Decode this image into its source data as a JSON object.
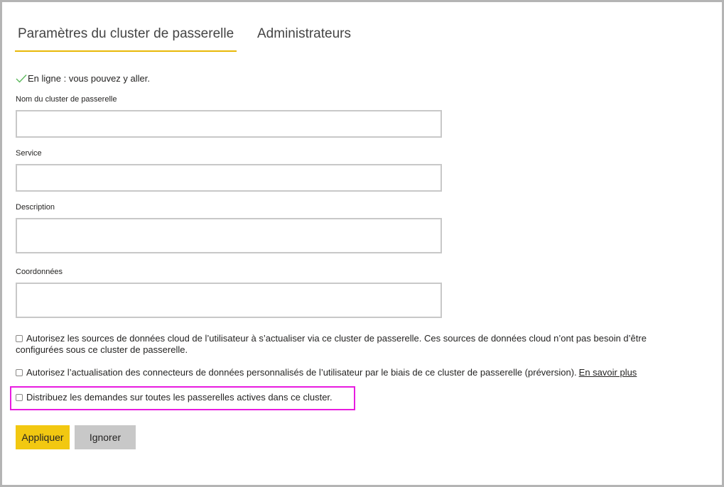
{
  "tabs": {
    "settings": "Paramètres du cluster de passerelle",
    "admins": "Administrateurs"
  },
  "status": {
    "text": "En ligne : vous pouvez y aller.",
    "icon": "check-icon",
    "color": "#5cb85c"
  },
  "form": {
    "cluster_name_label": "Nom du cluster de passerelle",
    "cluster_name_value": "",
    "service_label": "Service",
    "service_value": "",
    "description_label": "Description",
    "description_value": "",
    "contact_label": "Coordonnées",
    "contact_value": ""
  },
  "options": {
    "cloud_sources": "Autorisez les sources de données cloud de l’utilisateur à s’actualiser via ce cluster de passerelle. Ces sources de données cloud n’ont pas besoin d’être configurées sous ce cluster de passerelle.",
    "custom_connectors": "Autorisez l’actualisation des connecteurs de données personnalisés de l’utilisateur par le biais de ce cluster de passerelle (préversion).",
    "learn_more": "En savoir plus",
    "distribute": "Distribuez les demandes sur toutes les passerelles actives dans ce cluster."
  },
  "buttons": {
    "apply": "Appliquer",
    "ignore": "Ignorer"
  },
  "colors": {
    "accent": "#f2c811",
    "highlight": "#e81ce0"
  }
}
